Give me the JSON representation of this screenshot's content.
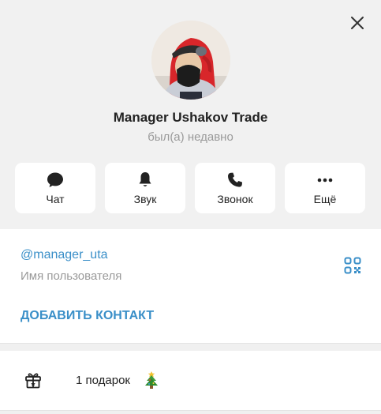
{
  "profile": {
    "name": "Manager Ushakov Trade",
    "status": "был(а) недавно"
  },
  "actions": [
    {
      "label": "Чат",
      "icon": "chat-bubble-icon"
    },
    {
      "label": "Звук",
      "icon": "bell-icon"
    },
    {
      "label": "Звонок",
      "icon": "phone-icon"
    },
    {
      "label": "Ещё",
      "icon": "more-dots-icon"
    }
  ],
  "info": {
    "username": "@manager_uta",
    "username_caption": "Имя пользователя",
    "add_contact_label": "ДОБАВИТЬ КОНТАКТ",
    "qr_icon": "qr-code-icon"
  },
  "gifts": {
    "text": "1 подарок",
    "icon": "gift-icon",
    "emoji_icon": "christmas-tree-icon"
  },
  "colors": {
    "accent": "#3a8fc8",
    "header_bg": "#f1f1f1",
    "card_bg": "#ffffff",
    "muted_text": "#9a9a9a"
  },
  "window": {
    "close_icon": "close-icon"
  }
}
